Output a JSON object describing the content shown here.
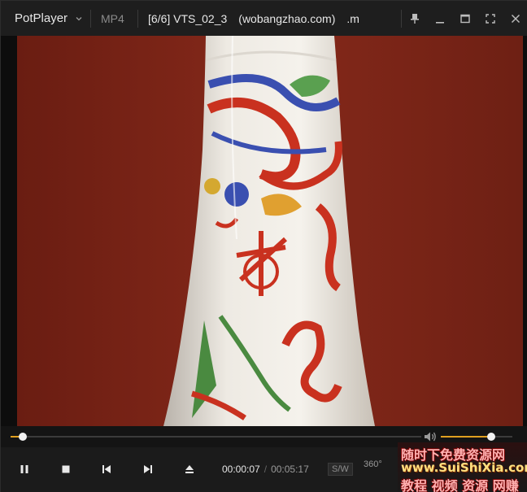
{
  "app": {
    "brand": "PotPlayer",
    "format": "MP4",
    "title": "[6/6] VTS_02_3　(wobangzhao.com)　.m"
  },
  "titlebar_icons": [
    "pin-icon",
    "minimize-icon",
    "maximize-icon",
    "fullscreen-icon",
    "close-icon"
  ],
  "playback": {
    "current_time": "00:00:07",
    "separator": "/",
    "total_time": "00:05:17",
    "progress_fraction": 0.03,
    "volume_fraction": 0.71,
    "sw_label": "S/W",
    "vr_label": "360°"
  },
  "controls": [
    "pause-icon",
    "stop-icon",
    "previous-icon",
    "next-icon",
    "eject-icon"
  ],
  "colors": {
    "accent": "#e0a020",
    "background": "#1b1b1b",
    "video_backdrop": "#7a2316"
  },
  "watermark": {
    "line1": "随时下免费资源网",
    "line2": "www.SuiShiXia.com",
    "line3": "教程 视频 资源 网赚"
  }
}
